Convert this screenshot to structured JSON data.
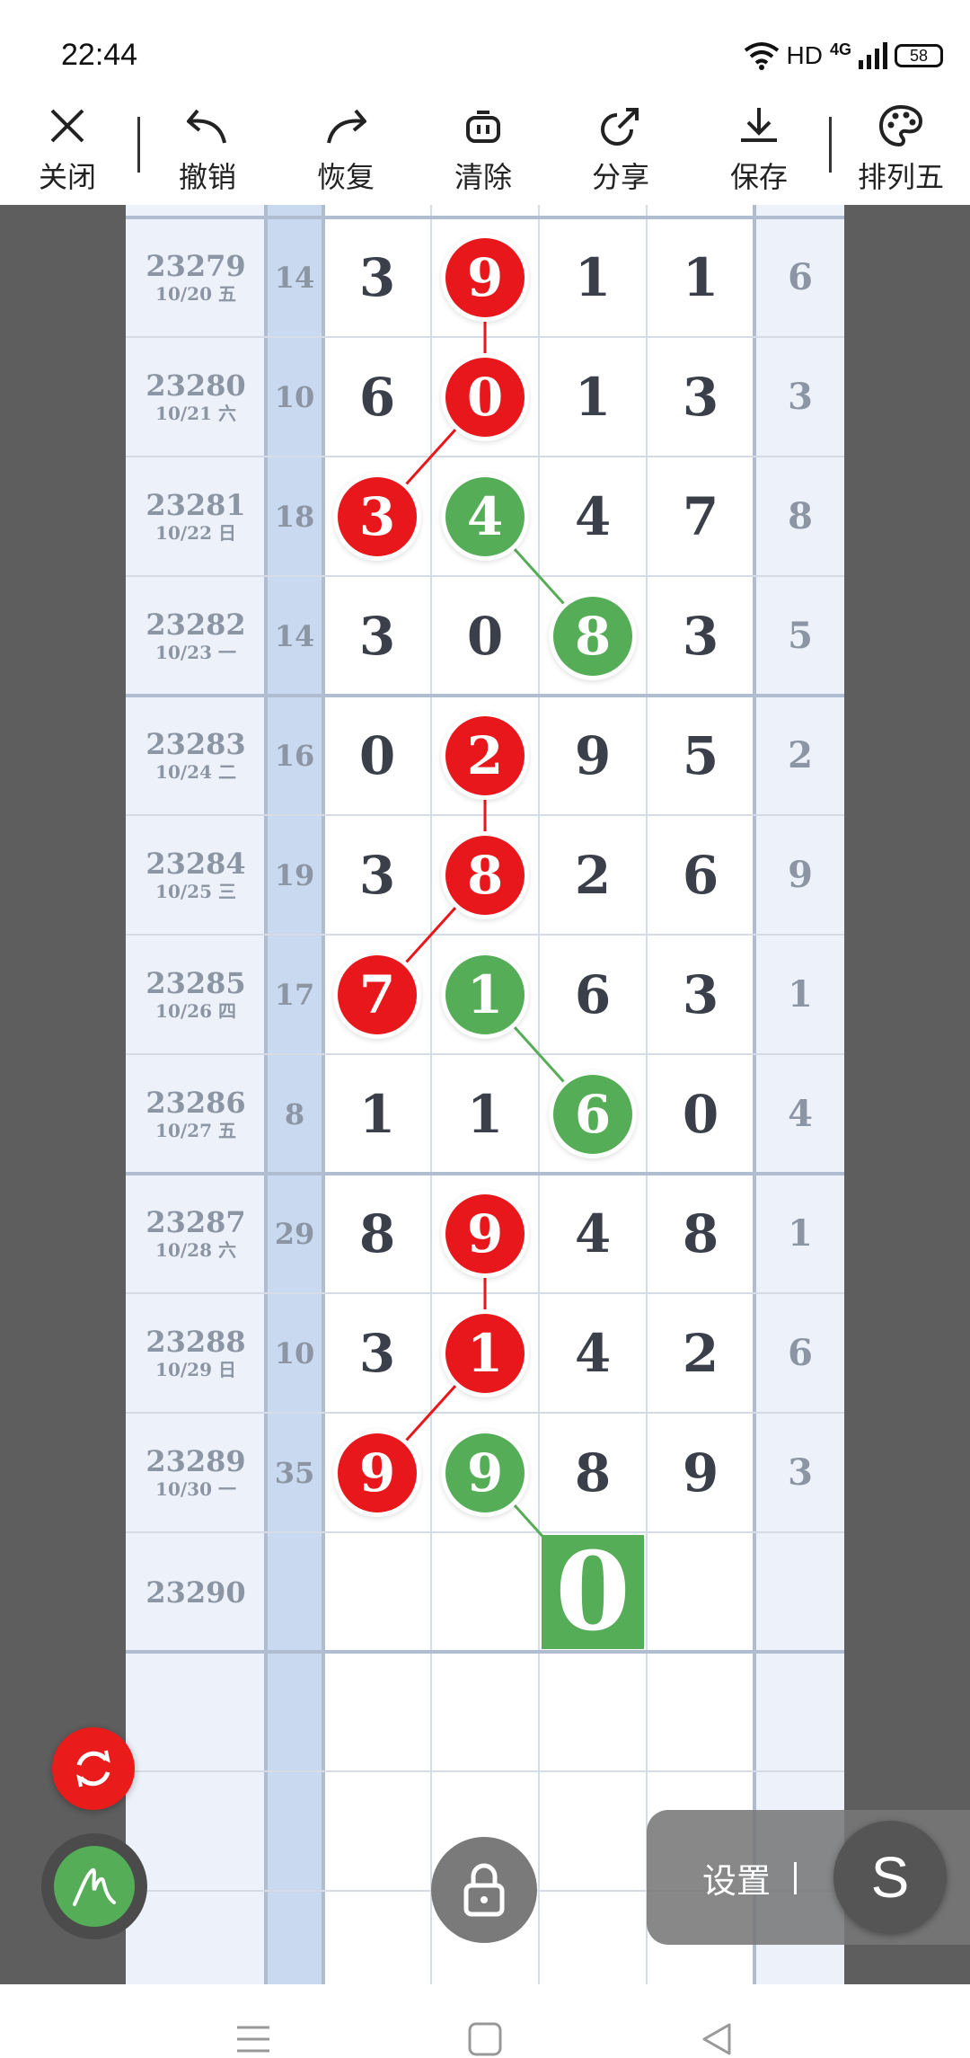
{
  "status_bar": {
    "time": "22:44",
    "network": "HD",
    "signal": "4G",
    "battery": "58"
  },
  "toolbar": {
    "close": "关闭",
    "undo": "撤销",
    "redo": "恢复",
    "clear": "清除",
    "share": "分享",
    "save": "保存",
    "theme": "排列五"
  },
  "colors": {
    "red_ball": "#e8171c",
    "green_ball": "#55ad57",
    "id_column": "#edf2fa",
    "sum_column": "#c9daf0"
  },
  "rows": [
    {
      "issue": "23279",
      "date": "10/20 五",
      "sum": "14",
      "digits": [
        "3",
        "9",
        "1",
        "1"
      ],
      "extra": "6",
      "marks": {
        "1": "red"
      }
    },
    {
      "issue": "23280",
      "date": "10/21 六",
      "sum": "10",
      "digits": [
        "6",
        "0",
        "1",
        "3"
      ],
      "extra": "3",
      "marks": {
        "1": "red"
      }
    },
    {
      "issue": "23281",
      "date": "10/22 日",
      "sum": "18",
      "digits": [
        "3",
        "4",
        "4",
        "7"
      ],
      "extra": "8",
      "marks": {
        "0": "red",
        "1": "green"
      }
    },
    {
      "issue": "23282",
      "date": "10/23 一",
      "sum": "14",
      "digits": [
        "3",
        "0",
        "8",
        "3"
      ],
      "extra": "5",
      "marks": {
        "2": "green"
      }
    },
    {
      "issue": "23283",
      "date": "10/24 二",
      "sum": "16",
      "digits": [
        "0",
        "2",
        "9",
        "5"
      ],
      "extra": "2",
      "marks": {
        "1": "red"
      }
    },
    {
      "issue": "23284",
      "date": "10/25 三",
      "sum": "19",
      "digits": [
        "3",
        "8",
        "2",
        "6"
      ],
      "extra": "9",
      "marks": {
        "1": "red"
      }
    },
    {
      "issue": "23285",
      "date": "10/26 四",
      "sum": "17",
      "digits": [
        "7",
        "1",
        "6",
        "3"
      ],
      "extra": "1",
      "marks": {
        "0": "red",
        "1": "green"
      }
    },
    {
      "issue": "23286",
      "date": "10/27 五",
      "sum": "8",
      "digits": [
        "1",
        "1",
        "6",
        "0"
      ],
      "extra": "4",
      "marks": {
        "2": "green"
      }
    },
    {
      "issue": "23287",
      "date": "10/28 六",
      "sum": "29",
      "digits": [
        "8",
        "9",
        "4",
        "8"
      ],
      "extra": "1",
      "marks": {
        "1": "red"
      }
    },
    {
      "issue": "23288",
      "date": "10/29 日",
      "sum": "10",
      "digits": [
        "3",
        "1",
        "4",
        "2"
      ],
      "extra": "6",
      "marks": {
        "1": "red"
      }
    },
    {
      "issue": "23289",
      "date": "10/30 一",
      "sum": "35",
      "digits": [
        "9",
        "9",
        "8",
        "9"
      ],
      "extra": "3",
      "marks": {
        "0": "red",
        "1": "green"
      }
    },
    {
      "issue": "23290",
      "date": "",
      "sum": "",
      "digits": [
        "",
        "",
        "",
        ""
      ],
      "extra": "",
      "marks": {}
    }
  ],
  "prediction": {
    "issue": "23290",
    "column": 2,
    "value": "0"
  },
  "links": {
    "red": [
      [
        0,
        1,
        1,
        1
      ],
      [
        1,
        1,
        2,
        0
      ],
      [
        4,
        1,
        5,
        1
      ],
      [
        5,
        1,
        6,
        0
      ],
      [
        8,
        1,
        9,
        1
      ],
      [
        9,
        1,
        10,
        0
      ]
    ],
    "green": [
      [
        2,
        1,
        3,
        2
      ],
      [
        6,
        1,
        7,
        2
      ],
      [
        10,
        1,
        11,
        2
      ]
    ]
  },
  "controls": {
    "settings": "设置",
    "floating_s": "S",
    "refresh_icon": "refresh-icon",
    "pen_icon": "pen-icon",
    "lock_icon": "lock-icon"
  },
  "nav": {
    "menu": "menu-icon",
    "home": "home-icon",
    "back": "back-icon"
  }
}
